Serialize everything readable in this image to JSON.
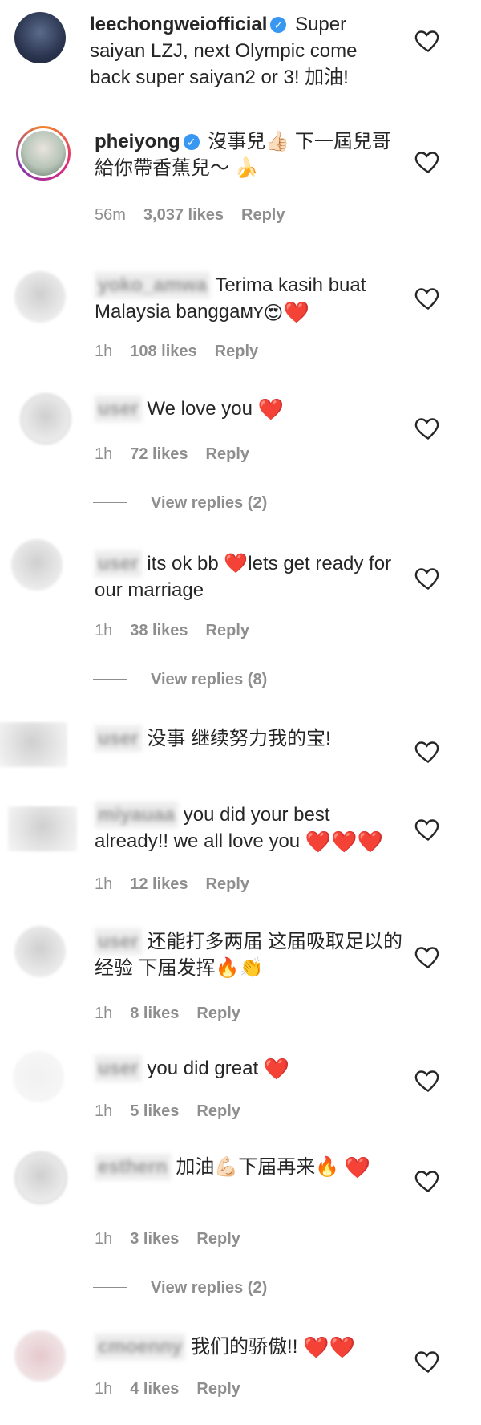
{
  "comments": [
    {
      "username": "leechongweiofficial",
      "verified": true,
      "text": "Super saiyan LZJ, next Olympic come back super saiyan2 or 3! 加油!",
      "emojis": [],
      "time": "",
      "likes": "",
      "reply": ""
    },
    {
      "username": "pheiyong",
      "verified": true,
      "text": "沒事兒👍🏻 下一屆兒哥給你帶香蕉兒～ 🍌",
      "emojis": [],
      "time": "56m",
      "likes": "3,037 likes",
      "reply": "Reply"
    },
    {
      "username": "yoko_amwa",
      "verified": false,
      "text": "Terima kasih buat Malaysia banggaᴍʏ",
      "emojis": [
        "😍",
        "❤️"
      ],
      "time": "1h",
      "likes": "108 likes",
      "reply": "Reply"
    },
    {
      "username": "user",
      "verified": false,
      "text": "We love you",
      "emojis": [
        "❤️"
      ],
      "time": "1h",
      "likes": "72 likes",
      "reply": "Reply",
      "view_replies": "View replies (2)"
    },
    {
      "username": "user",
      "verified": false,
      "text": "its ok bb ❤️lets get ready for our marriage",
      "emojis": [],
      "time": "1h",
      "likes": "38 likes",
      "reply": "Reply",
      "view_replies": "View replies (8)"
    },
    {
      "username": "user",
      "verified": false,
      "text": "没事 继续努力我的宝!",
      "emojis": [],
      "time": "",
      "likes": "",
      "reply": ""
    },
    {
      "username": "miyauaa",
      "verified": false,
      "text": "you did your best already!! we all love you",
      "emojis": [
        "❤️",
        "❤️",
        "❤️"
      ],
      "time": "1h",
      "likes": "12 likes",
      "reply": "Reply"
    },
    {
      "username": "user",
      "verified": false,
      "text": "还能打多两届 这届吸取足以的经验 下届发挥🔥👏",
      "emojis": [],
      "time": "1h",
      "likes": "8 likes",
      "reply": "Reply"
    },
    {
      "username": "user",
      "verified": false,
      "text": "you did great",
      "emojis": [
        "❤️"
      ],
      "time": "1h",
      "likes": "5 likes",
      "reply": "Reply"
    },
    {
      "username": "esthern",
      "verified": false,
      "text": "加油💪🏻下届再来🔥",
      "emojis": [
        "❤️"
      ],
      "time": "1h",
      "likes": "3 likes",
      "reply": "Reply",
      "view_replies": "View replies (2)"
    },
    {
      "username": "cmoenny",
      "verified": false,
      "text": "我们的骄傲!!",
      "emojis": [
        "❤️",
        "❤️"
      ],
      "time": "1h",
      "likes": "4 likes",
      "reply": "Reply"
    }
  ],
  "icons": {
    "like": "heart-outline-icon",
    "verified": "verified-badge-icon"
  }
}
